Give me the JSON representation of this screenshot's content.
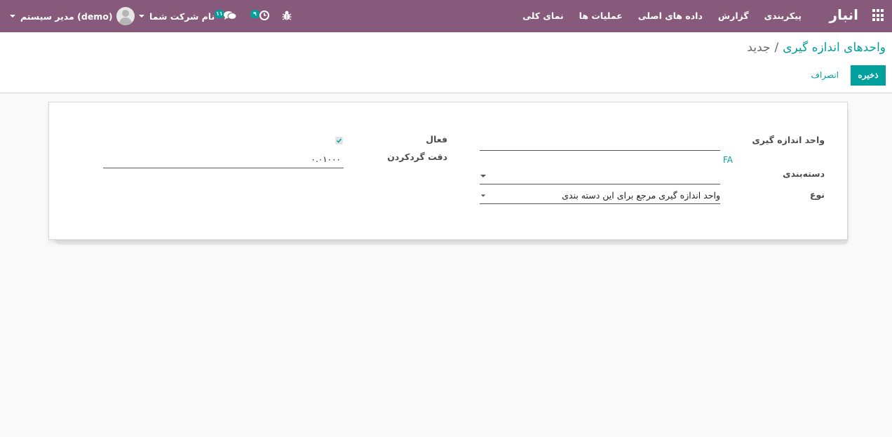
{
  "navbar": {
    "brand": "انبار",
    "menu": [
      "نمای کلی",
      "عملیات ها",
      "داده های اصلی",
      "گزارش",
      "پیکربندی"
    ],
    "user_name": "مدیر سیستم (demo)",
    "company_name": "نام شرکت شما",
    "messages_count": "۱۱",
    "activities_count": "۹",
    "icons": {
      "apps": "apps-grid-icon",
      "chat": "chat-icon",
      "activity": "clock-icon",
      "debug": "bug-icon",
      "avatar": "user-avatar-icon"
    },
    "color": "#875a7b"
  },
  "control_panel": {
    "breadcrumb_parent": "واحدهای اندازه گیری",
    "breadcrumb_separator": "/",
    "breadcrumb_current": "جدید",
    "save_label": "ذخیره",
    "discard_label": "انصراف",
    "accent_color": "#00a09d"
  },
  "form": {
    "uom_name_label": "واحد اندازه گیری",
    "uom_name_value": "",
    "translate_label": "FA",
    "category_label": "دسته‌بندی",
    "category_value": "",
    "type_label": "نوع",
    "type_value": "واحد اندازه گیری مرجع برای این دسته بندی",
    "active_label": "فعال",
    "active_checked": true,
    "rounding_label": "دقت گردکردن",
    "rounding_value": "۰.۰۱۰۰۰"
  }
}
